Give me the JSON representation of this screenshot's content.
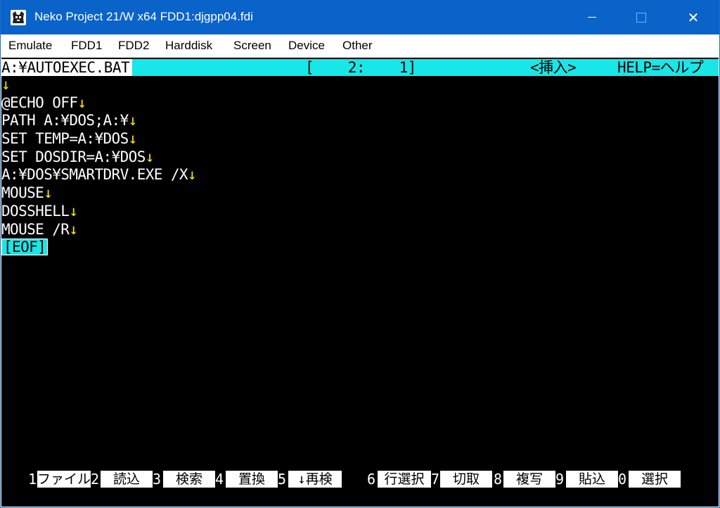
{
  "window": {
    "title": "Neko Project 21/W x64  FDD1:djgpp04.fdi",
    "controls": {
      "minimize": "—",
      "maximize": "☐",
      "close": "✕"
    }
  },
  "menu": {
    "items": [
      "Emulate",
      "FDD1",
      "FDD2",
      "Harddisk",
      "Screen",
      "Device",
      "Other"
    ]
  },
  "editor": {
    "status": {
      "filename": "A:¥AUTOEXEC.BAT",
      "position": "[    2:    1]",
      "mode": "<挿入>",
      "help": "HELP=ヘルプ"
    },
    "return_mark": "↓",
    "lines": [
      "",
      "@ECHO OFF",
      "PATH A:¥DOS;A:¥",
      "SET TEMP=A:¥DOS",
      "SET DOSDIR=A:¥DOS",
      "A:¥DOS¥SMARTDRV.EXE /X",
      "MOUSE",
      "DOSSHELL",
      "MOUSE /R"
    ],
    "eof_marker": "[EOF]",
    "function_keys": [
      {
        "num": "1",
        "label": "ファイル"
      },
      {
        "num": "2",
        "label": "読込"
      },
      {
        "num": "3",
        "label": "検索"
      },
      {
        "num": "4",
        "label": "置換"
      },
      {
        "num": "5",
        "label": "↓再検"
      },
      {
        "num": "6",
        "label": "行選択"
      },
      {
        "num": "7",
        "label": "切取"
      },
      {
        "num": "8",
        "label": "複写"
      },
      {
        "num": "9",
        "label": "貼込"
      },
      {
        "num": "0",
        "label": "選択"
      }
    ]
  },
  "colors": {
    "titlebar": "#0a63c9",
    "status_bg": "#19e6e6",
    "return_mark": "#ffe800"
  }
}
